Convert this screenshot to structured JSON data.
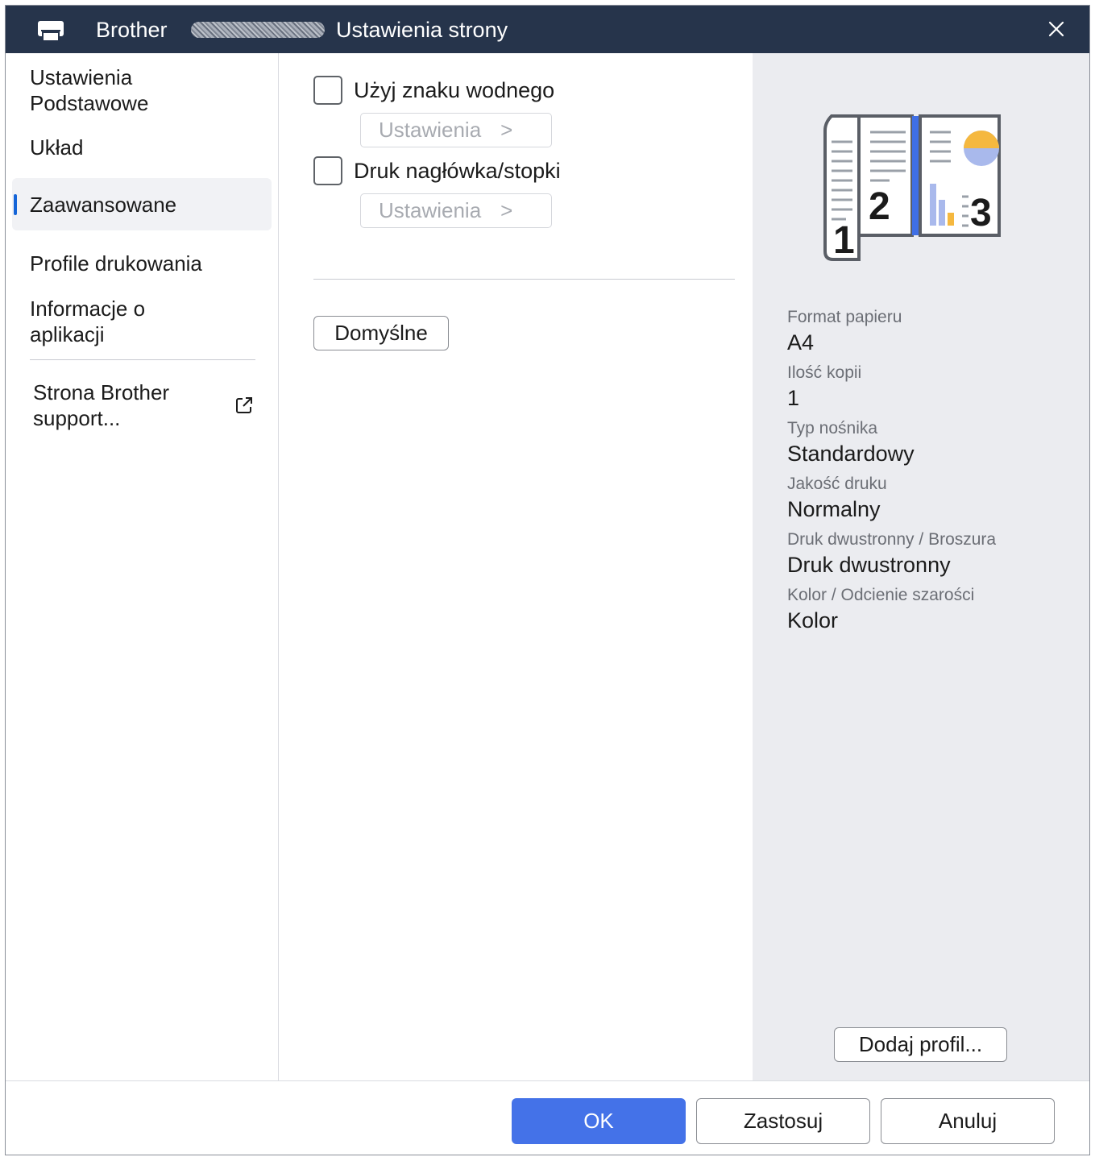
{
  "window": {
    "brand": "Brother",
    "title": "Ustawienia strony",
    "colors": {
      "titlebar": "#26344b",
      "accent": "#1565d8",
      "ok_button": "#4472e8",
      "summary_bg": "#ebecf0"
    }
  },
  "sidebar": {
    "items": [
      {
        "line1": "Ustawienia",
        "line2": "Podstawowe"
      },
      {
        "line1": "Układ"
      },
      {
        "line1": "Zaawansowane",
        "active": true
      },
      {
        "line1": "Profile drukowania"
      },
      {
        "line1": "Informacje o",
        "line2": "aplikacji"
      }
    ],
    "support": {
      "line1": "Strona Brother",
      "line2": "support...",
      "icon": "external-link-icon"
    }
  },
  "main": {
    "watermark": {
      "label": "Użyj znaku wodnego",
      "checked": false,
      "settings_label": "Ustawienia",
      "chevron": ">"
    },
    "header_footer": {
      "label": "Druk nagłówka/stopki",
      "checked": false,
      "settings_label": "Ustawienia",
      "chevron": ">"
    },
    "default_button": "Domyślne"
  },
  "summary": {
    "preview_numbers": [
      "1",
      "2",
      "3"
    ],
    "fields": [
      {
        "label": "Format papieru",
        "value": "A4"
      },
      {
        "label": "Ilość kopii",
        "value": "1"
      },
      {
        "label": "Typ nośnika",
        "value": "Standardowy"
      },
      {
        "label": "Jakość druku",
        "value": "Normalny"
      },
      {
        "label": "Druk dwustronny / Broszura",
        "value": "Druk dwustronny"
      },
      {
        "label": "Kolor / Odcienie szarości",
        "value": "Kolor"
      }
    ],
    "add_profile_button": "Dodaj profil..."
  },
  "footer": {
    "ok": "OK",
    "apply": "Zastosuj",
    "cancel": "Anuluj"
  }
}
